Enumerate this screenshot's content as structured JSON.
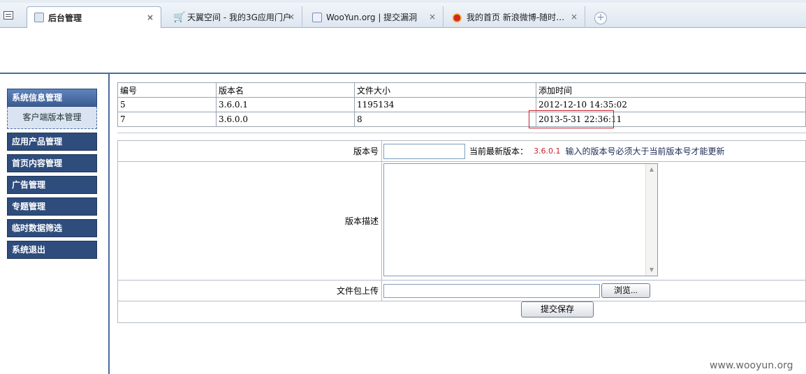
{
  "browser": {
    "tabs": [
      {
        "title": "后台管理",
        "active": true,
        "icon": "admin-page-icon"
      },
      {
        "title": "天翼空间 - 我的3G应用门户",
        "active": false,
        "icon": "cart-icon"
      },
      {
        "title": "WooYun.org | 提交漏洞",
        "active": false,
        "icon": "page-icon"
      },
      {
        "title": "我的首页 新浪微博-随时…",
        "active": false,
        "icon": "weibo-icon"
      }
    ],
    "close_glyph": "×",
    "new_tab_glyph": "+"
  },
  "sidebar": {
    "section": "系统信息管理",
    "sub_item": "客户端版本管理",
    "items": [
      "应用产品管理",
      "首页内容管理",
      "广告管理",
      "专题管理",
      "临时数据筛选",
      "系统退出"
    ]
  },
  "version_table": {
    "columns": [
      "编号",
      "版本名",
      "文件大小",
      "添加时间"
    ],
    "rows": [
      [
        "5",
        "3.6.0.1",
        "1195134",
        "2012-12-10 14:35:02"
      ],
      [
        "7",
        "3.6.0.0",
        "8",
        "2013-5-31 22:36:11"
      ]
    ]
  },
  "form": {
    "version_label": "版本号",
    "version_value": "",
    "latest_label": "当前最新版本：",
    "latest_value": "3.6.0.1",
    "rule_hint": "输入的版本号必须大于当前版本号才能更新",
    "desc_label": "版本描述",
    "upload_label": "文件包上传",
    "browse_button": "浏览...",
    "submit_button": "提交保存"
  },
  "watermark": "www.wooyun.org",
  "colors": {
    "accent": "#476ba0",
    "highlight": "#c8202a"
  }
}
